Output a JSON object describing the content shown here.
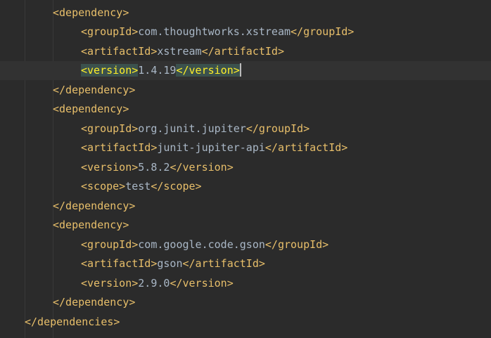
{
  "editor": {
    "lines": [
      {
        "indent": 2,
        "open": "<dependency>",
        "text": "",
        "close": ""
      },
      {
        "indent": 3,
        "open": "<groupId>",
        "text": "com.thoughtworks.xstream",
        "close": "</groupId>"
      },
      {
        "indent": 3,
        "open": "<artifactId>",
        "text": "xstream",
        "close": "</artifactId>"
      },
      {
        "indent": 3,
        "open": "<version>",
        "text": "1.4.19",
        "close": "</version>",
        "current": true,
        "match": true,
        "caret": true
      },
      {
        "indent": 2,
        "open": "</dependency>",
        "text": "",
        "close": ""
      },
      {
        "indent": 2,
        "open": "<dependency>",
        "text": "",
        "close": ""
      },
      {
        "indent": 3,
        "open": "<groupId>",
        "text": "org.junit.jupiter",
        "close": "</groupId>"
      },
      {
        "indent": 3,
        "open": "<artifactId>",
        "text": "junit-jupiter-api",
        "close": "</artifactId>"
      },
      {
        "indent": 3,
        "open": "<version>",
        "text": "5.8.2",
        "close": "</version>"
      },
      {
        "indent": 3,
        "open": "<scope>",
        "text": "test",
        "close": "</scope>"
      },
      {
        "indent": 2,
        "open": "</dependency>",
        "text": "",
        "close": ""
      },
      {
        "indent": 2,
        "open": "<dependency>",
        "text": "",
        "close": ""
      },
      {
        "indent": 3,
        "open": "<groupId>",
        "text": "com.google.code.gson",
        "close": "</groupId>"
      },
      {
        "indent": 3,
        "open": "<artifactId>",
        "text": "gson",
        "close": "</artifactId>"
      },
      {
        "indent": 3,
        "open": "<version>",
        "text": "2.9.0",
        "close": "</version>"
      },
      {
        "indent": 2,
        "open": "</dependency>",
        "text": "",
        "close": ""
      },
      {
        "indent": 1,
        "open": "</dependencies>",
        "text": "",
        "close": ""
      }
    ]
  },
  "colors": {
    "background": "#2b2b2b",
    "tag": "#e8bf6a",
    "text": "#a9b7c6",
    "match_bg": "#3b514d",
    "match_fg": "#ffef28",
    "current_line": "#323232"
  }
}
